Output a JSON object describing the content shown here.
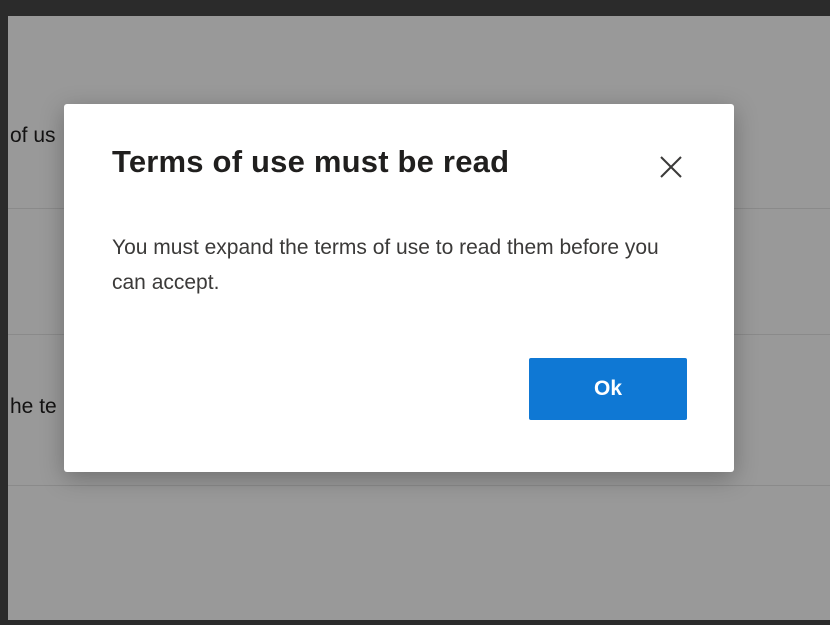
{
  "background": {
    "row1_text": "of us",
    "row3_text": "he te"
  },
  "dialog": {
    "title": "Terms of use must be read",
    "message": "You must expand the terms of use to read them before you can accept.",
    "ok_label": "Ok",
    "close_icon": "close-icon"
  },
  "colors": {
    "primary_button": "#0f78d4",
    "overlay": "rgba(0,0,0,0.4)",
    "title_text": "#201f1e",
    "body_text": "#3b3a39"
  }
}
